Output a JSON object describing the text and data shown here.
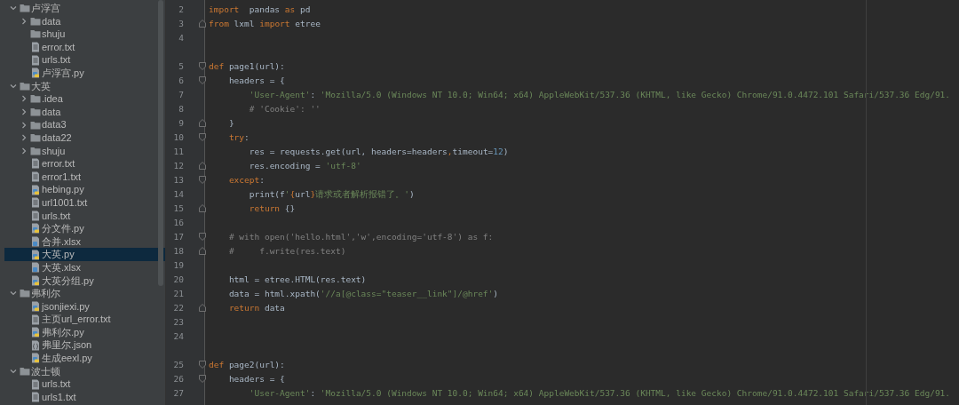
{
  "project_tree": [
    {
      "name": "卢浮宫",
      "kind": "folder",
      "expanded": true,
      "selected": false,
      "children": [
        {
          "name": "data",
          "kind": "folder",
          "expanded": false,
          "selected": false
        },
        {
          "name": "shuju",
          "kind": "empty-folder",
          "selected": false
        },
        {
          "name": "error.txt",
          "kind": "text",
          "selected": false
        },
        {
          "name": "urls.txt",
          "kind": "text",
          "selected": false
        },
        {
          "name": "卢浮宫.py",
          "kind": "python",
          "selected": false
        }
      ]
    },
    {
      "name": "大英",
      "kind": "folder",
      "expanded": true,
      "selected": false,
      "children": [
        {
          "name": ".idea",
          "kind": "folder",
          "expanded": false,
          "selected": false
        },
        {
          "name": "data",
          "kind": "folder",
          "expanded": false,
          "selected": false
        },
        {
          "name": "data3",
          "kind": "folder",
          "expanded": false,
          "selected": false
        },
        {
          "name": "data22",
          "kind": "folder",
          "expanded": false,
          "selected": false
        },
        {
          "name": "shuju",
          "kind": "folder",
          "expanded": false,
          "selected": false
        },
        {
          "name": "error.txt",
          "kind": "text",
          "selected": false
        },
        {
          "name": "error1.txt",
          "kind": "text",
          "selected": false
        },
        {
          "name": "hebing.py",
          "kind": "python",
          "selected": false
        },
        {
          "name": "url1001.txt",
          "kind": "text",
          "selected": false
        },
        {
          "name": "urls.txt",
          "kind": "text",
          "selected": false
        },
        {
          "name": "分文件.py",
          "kind": "python",
          "selected": false
        },
        {
          "name": "合并.xlsx",
          "kind": "unknown",
          "selected": false
        },
        {
          "name": "大英.py",
          "kind": "python",
          "selected": true
        },
        {
          "name": "大英.xlsx",
          "kind": "unknown",
          "selected": false
        },
        {
          "name": "大英分组.py",
          "kind": "python",
          "selected": false
        }
      ]
    },
    {
      "name": "弗利尔",
      "kind": "folder",
      "expanded": true,
      "selected": false,
      "children": [
        {
          "name": "jsonjiexi.py",
          "kind": "python",
          "selected": false
        },
        {
          "name": "主页url_error.txt",
          "kind": "text",
          "selected": false
        },
        {
          "name": "弗利尔.py",
          "kind": "python",
          "selected": false
        },
        {
          "name": "弗里尔.json",
          "kind": "json",
          "selected": false
        },
        {
          "name": "生成eexl.py",
          "kind": "python",
          "selected": false
        }
      ]
    },
    {
      "name": "波士顿",
      "kind": "folder",
      "expanded": true,
      "selected": false,
      "children": [
        {
          "name": "urls.txt",
          "kind": "text",
          "selected": false
        },
        {
          "name": "urls1.txt",
          "kind": "text",
          "selected": false
        }
      ]
    }
  ],
  "editor": {
    "lines": [
      {
        "number": "2",
        "fold_open": false,
        "fold_close": false,
        "spacer_after": false,
        "tokens": [
          {
            "kind": "keyword",
            "text": "import"
          },
          {
            "kind": "plain",
            "text": "  pandas "
          },
          {
            "kind": "keyword",
            "text": "as"
          },
          {
            "kind": "plain",
            "text": " pd"
          }
        ]
      },
      {
        "number": "3",
        "fold_open": false,
        "fold_close": true,
        "spacer_after": false,
        "tokens": [
          {
            "kind": "keyword",
            "text": "from"
          },
          {
            "kind": "plain",
            "text": " lxml "
          },
          {
            "kind": "keyword",
            "text": "import"
          },
          {
            "kind": "plain",
            "text": " etree"
          }
        ]
      },
      {
        "number": "4",
        "fold_open": false,
        "fold_close": false,
        "spacer_after": true
      },
      {
        "number": "5",
        "fold_open": true,
        "fold_close": false,
        "spacer_after": false,
        "tokens": [
          {
            "kind": "keyword",
            "text": "def"
          },
          {
            "kind": "plain",
            "text": " page1(url):"
          }
        ]
      },
      {
        "number": "6",
        "fold_open": true,
        "fold_close": false,
        "spacer_after": false,
        "tokens": [
          {
            "kind": "plain",
            "text": "    headers = {"
          }
        ]
      },
      {
        "number": "7",
        "fold_open": false,
        "fold_close": false,
        "spacer_after": false,
        "tokens": [
          {
            "kind": "string",
            "text": "        'User-Agent'"
          },
          {
            "kind": "plain",
            "text": ": "
          },
          {
            "kind": "string",
            "text": "'Mozilla/5.0 (Windows NT 10.0; Win64; x64) AppleWebKit/537.36 (KHTML, like Gecko) Chrome/91.0.4472.101 Safari/537.36 Edg/91."
          }
        ]
      },
      {
        "number": "8",
        "fold_open": false,
        "fold_close": false,
        "spacer_after": false,
        "tokens": [
          {
            "kind": "comment",
            "text": "        # 'Cookie': ''"
          }
        ]
      },
      {
        "number": "9",
        "fold_open": false,
        "fold_close": true,
        "spacer_after": false,
        "tokens": [
          {
            "kind": "plain",
            "text": "    }"
          }
        ]
      },
      {
        "number": "10",
        "fold_open": true,
        "fold_close": false,
        "spacer_after": false,
        "tokens": [
          {
            "kind": "keyword",
            "text": "    try"
          },
          {
            "kind": "plain",
            "text": ":"
          }
        ]
      },
      {
        "number": "11",
        "fold_open": false,
        "fold_close": false,
        "spacer_after": false,
        "tokens": [
          {
            "kind": "plain",
            "text": "        res = requests.get(url, headers=headers"
          },
          {
            "kind": "keyword",
            "text": ","
          },
          {
            "kind": "plain",
            "text": "timeout="
          },
          {
            "kind": "number",
            "text": "12"
          },
          {
            "kind": "plain",
            "text": ")"
          }
        ]
      },
      {
        "number": "12",
        "fold_open": false,
        "fold_close": true,
        "spacer_after": false,
        "tokens": [
          {
            "kind": "plain",
            "text": "        res.encoding = "
          },
          {
            "kind": "string",
            "text": "'utf-8'"
          }
        ]
      },
      {
        "number": "13",
        "fold_open": true,
        "fold_close": false,
        "spacer_after": false,
        "tokens": [
          {
            "kind": "keyword",
            "text": "    except"
          },
          {
            "kind": "plain",
            "text": ":"
          }
        ]
      },
      {
        "number": "14",
        "fold_open": false,
        "fold_close": false,
        "spacer_after": false,
        "tokens": [
          {
            "kind": "plain",
            "text": "        print(f"
          },
          {
            "kind": "string",
            "text": "'"
          },
          {
            "kind": "keyword",
            "text": "{"
          },
          {
            "kind": "plain",
            "text": "url"
          },
          {
            "kind": "keyword",
            "text": "}"
          },
          {
            "kind": "string",
            "text": "请求或者解析报错了。"
          },
          {
            "kind": "string",
            "text": "'"
          },
          {
            "kind": "plain",
            "text": ")"
          }
        ]
      },
      {
        "number": "15",
        "fold_open": false,
        "fold_close": true,
        "spacer_after": false,
        "tokens": [
          {
            "kind": "keyword",
            "text": "        return"
          },
          {
            "kind": "plain",
            "text": " {}"
          }
        ]
      },
      {
        "number": "16",
        "fold_open": false,
        "fold_close": false,
        "spacer_after": false
      },
      {
        "number": "17",
        "fold_open": true,
        "fold_close": false,
        "spacer_after": false,
        "tokens": [
          {
            "kind": "comment",
            "text": "    # with open('hello.html','w',encoding='utf-8') as f:"
          }
        ]
      },
      {
        "number": "18",
        "fold_open": false,
        "fold_close": true,
        "spacer_after": false,
        "tokens": [
          {
            "kind": "comment",
            "text": "    #     f.write(res.text)"
          }
        ]
      },
      {
        "number": "19",
        "fold_open": false,
        "fold_close": false,
        "spacer_after": false
      },
      {
        "number": "20",
        "fold_open": false,
        "fold_close": false,
        "spacer_after": false,
        "tokens": [
          {
            "kind": "plain",
            "text": "    html = etree.HTML(res.text)"
          }
        ]
      },
      {
        "number": "21",
        "fold_open": false,
        "fold_close": false,
        "spacer_after": false,
        "tokens": [
          {
            "kind": "plain",
            "text": "    data = html.xpath("
          },
          {
            "kind": "string",
            "text": "'//a[@class=\"teaser__link\"]/@href'"
          },
          {
            "kind": "plain",
            "text": ")"
          }
        ]
      },
      {
        "number": "22",
        "fold_open": false,
        "fold_close": true,
        "spacer_after": false,
        "tokens": [
          {
            "kind": "keyword",
            "text": "    return"
          },
          {
            "kind": "plain",
            "text": " data"
          }
        ]
      },
      {
        "number": "23",
        "fold_open": false,
        "fold_close": false,
        "spacer_after": false
      },
      {
        "number": "24",
        "fold_open": false,
        "fold_close": false,
        "spacer_after": true
      },
      {
        "number": "25",
        "fold_open": true,
        "fold_close": false,
        "spacer_after": false,
        "tokens": [
          {
            "kind": "keyword",
            "text": "def"
          },
          {
            "kind": "plain",
            "text": " page2(url):"
          }
        ]
      },
      {
        "number": "26",
        "fold_open": true,
        "fold_close": false,
        "spacer_after": false,
        "tokens": [
          {
            "kind": "plain",
            "text": "    headers = {"
          }
        ]
      },
      {
        "number": "27",
        "fold_open": false,
        "fold_close": false,
        "spacer_after": false,
        "tokens": [
          {
            "kind": "string",
            "text": "        'User-Agent'"
          },
          {
            "kind": "plain",
            "text": ": "
          },
          {
            "kind": "string",
            "text": "'Mozilla/5.0 (Windows NT 10.0; Win64; x64) AppleWebKit/537.36 (KHTML, like Gecko) Chrome/91.0.4472.101 Safari/537.36 Edg/91."
          }
        ]
      }
    ]
  }
}
